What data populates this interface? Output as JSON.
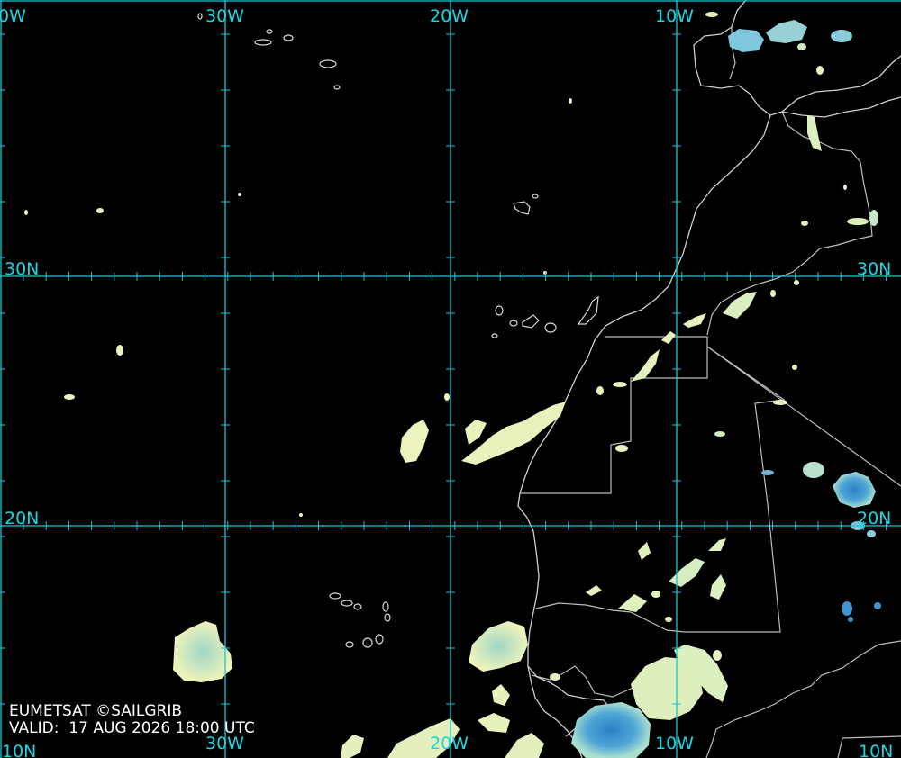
{
  "map": {
    "longitude_labels": [
      "0W",
      "30W",
      "20W",
      "10W"
    ],
    "longitude_labels_bottom": [
      "10N",
      "30W",
      "20W",
      "10W",
      "10N"
    ],
    "latitude_labels_left": [
      "30N",
      "20N"
    ],
    "latitude_labels_right": [
      "30N",
      "20N"
    ],
    "colors": {
      "grid": "#16c9d4",
      "coastline": "#cfcfcf",
      "cloud_light": "#f3f5bd",
      "cloud_mid": "#b8e4c0",
      "cloud_cold": "#5fb6d8",
      "cloud_coldest": "#2c7fc4"
    }
  },
  "credit": {
    "line1": "EUMETSAT ©SAILGRIB",
    "line2": "VALID:  17 AUG 2026 18:00 UTC"
  }
}
